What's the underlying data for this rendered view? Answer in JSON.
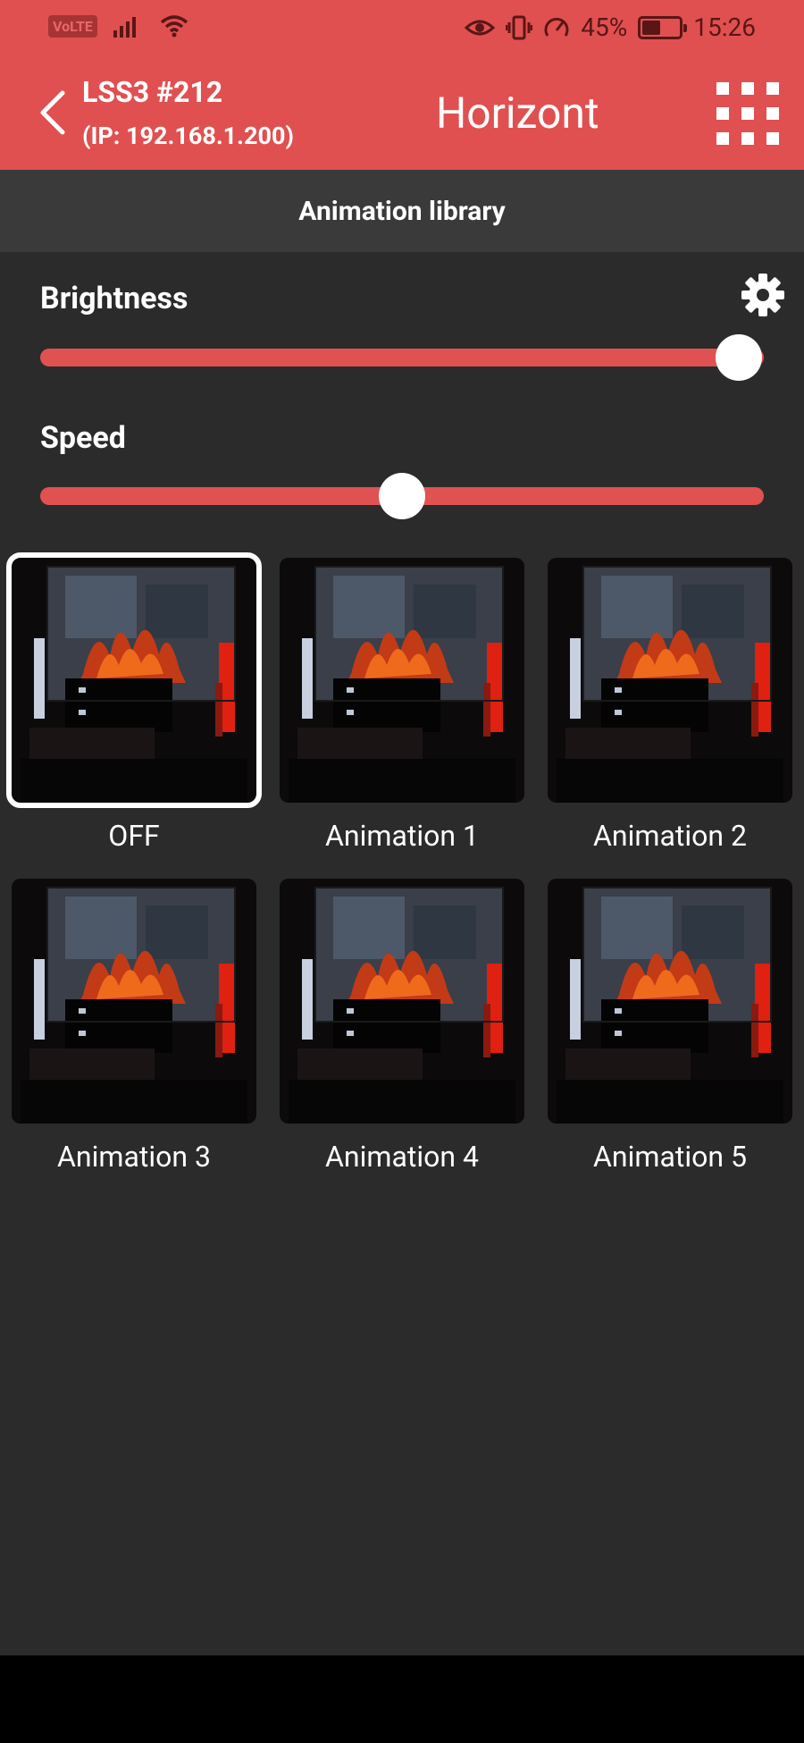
{
  "status_bar": {
    "network_badge": "VoLTE",
    "battery_percent": "45%",
    "battery_level": 0.45,
    "time": "15:26",
    "icons": [
      "signal-icon",
      "wifi-icon",
      "eye-icon",
      "vibrate-icon",
      "speed-icon",
      "battery-icon"
    ]
  },
  "header": {
    "device_name": "LSS3 #212",
    "device_ip": "(IP: 192.168.1.200)",
    "title": "Horizont",
    "accent_color": "#e05050"
  },
  "subheader": {
    "title": "Animation library"
  },
  "brightness": {
    "label": "Brightness",
    "value": 1.0
  },
  "speed": {
    "label": "Speed",
    "value": 0.5
  },
  "animations": [
    {
      "label": "OFF",
      "selected": true
    },
    {
      "label": "Animation 1",
      "selected": false
    },
    {
      "label": "Animation 2",
      "selected": false
    },
    {
      "label": "Animation 3",
      "selected": false
    },
    {
      "label": "Animation 4",
      "selected": false
    },
    {
      "label": "Animation 5",
      "selected": false
    }
  ]
}
